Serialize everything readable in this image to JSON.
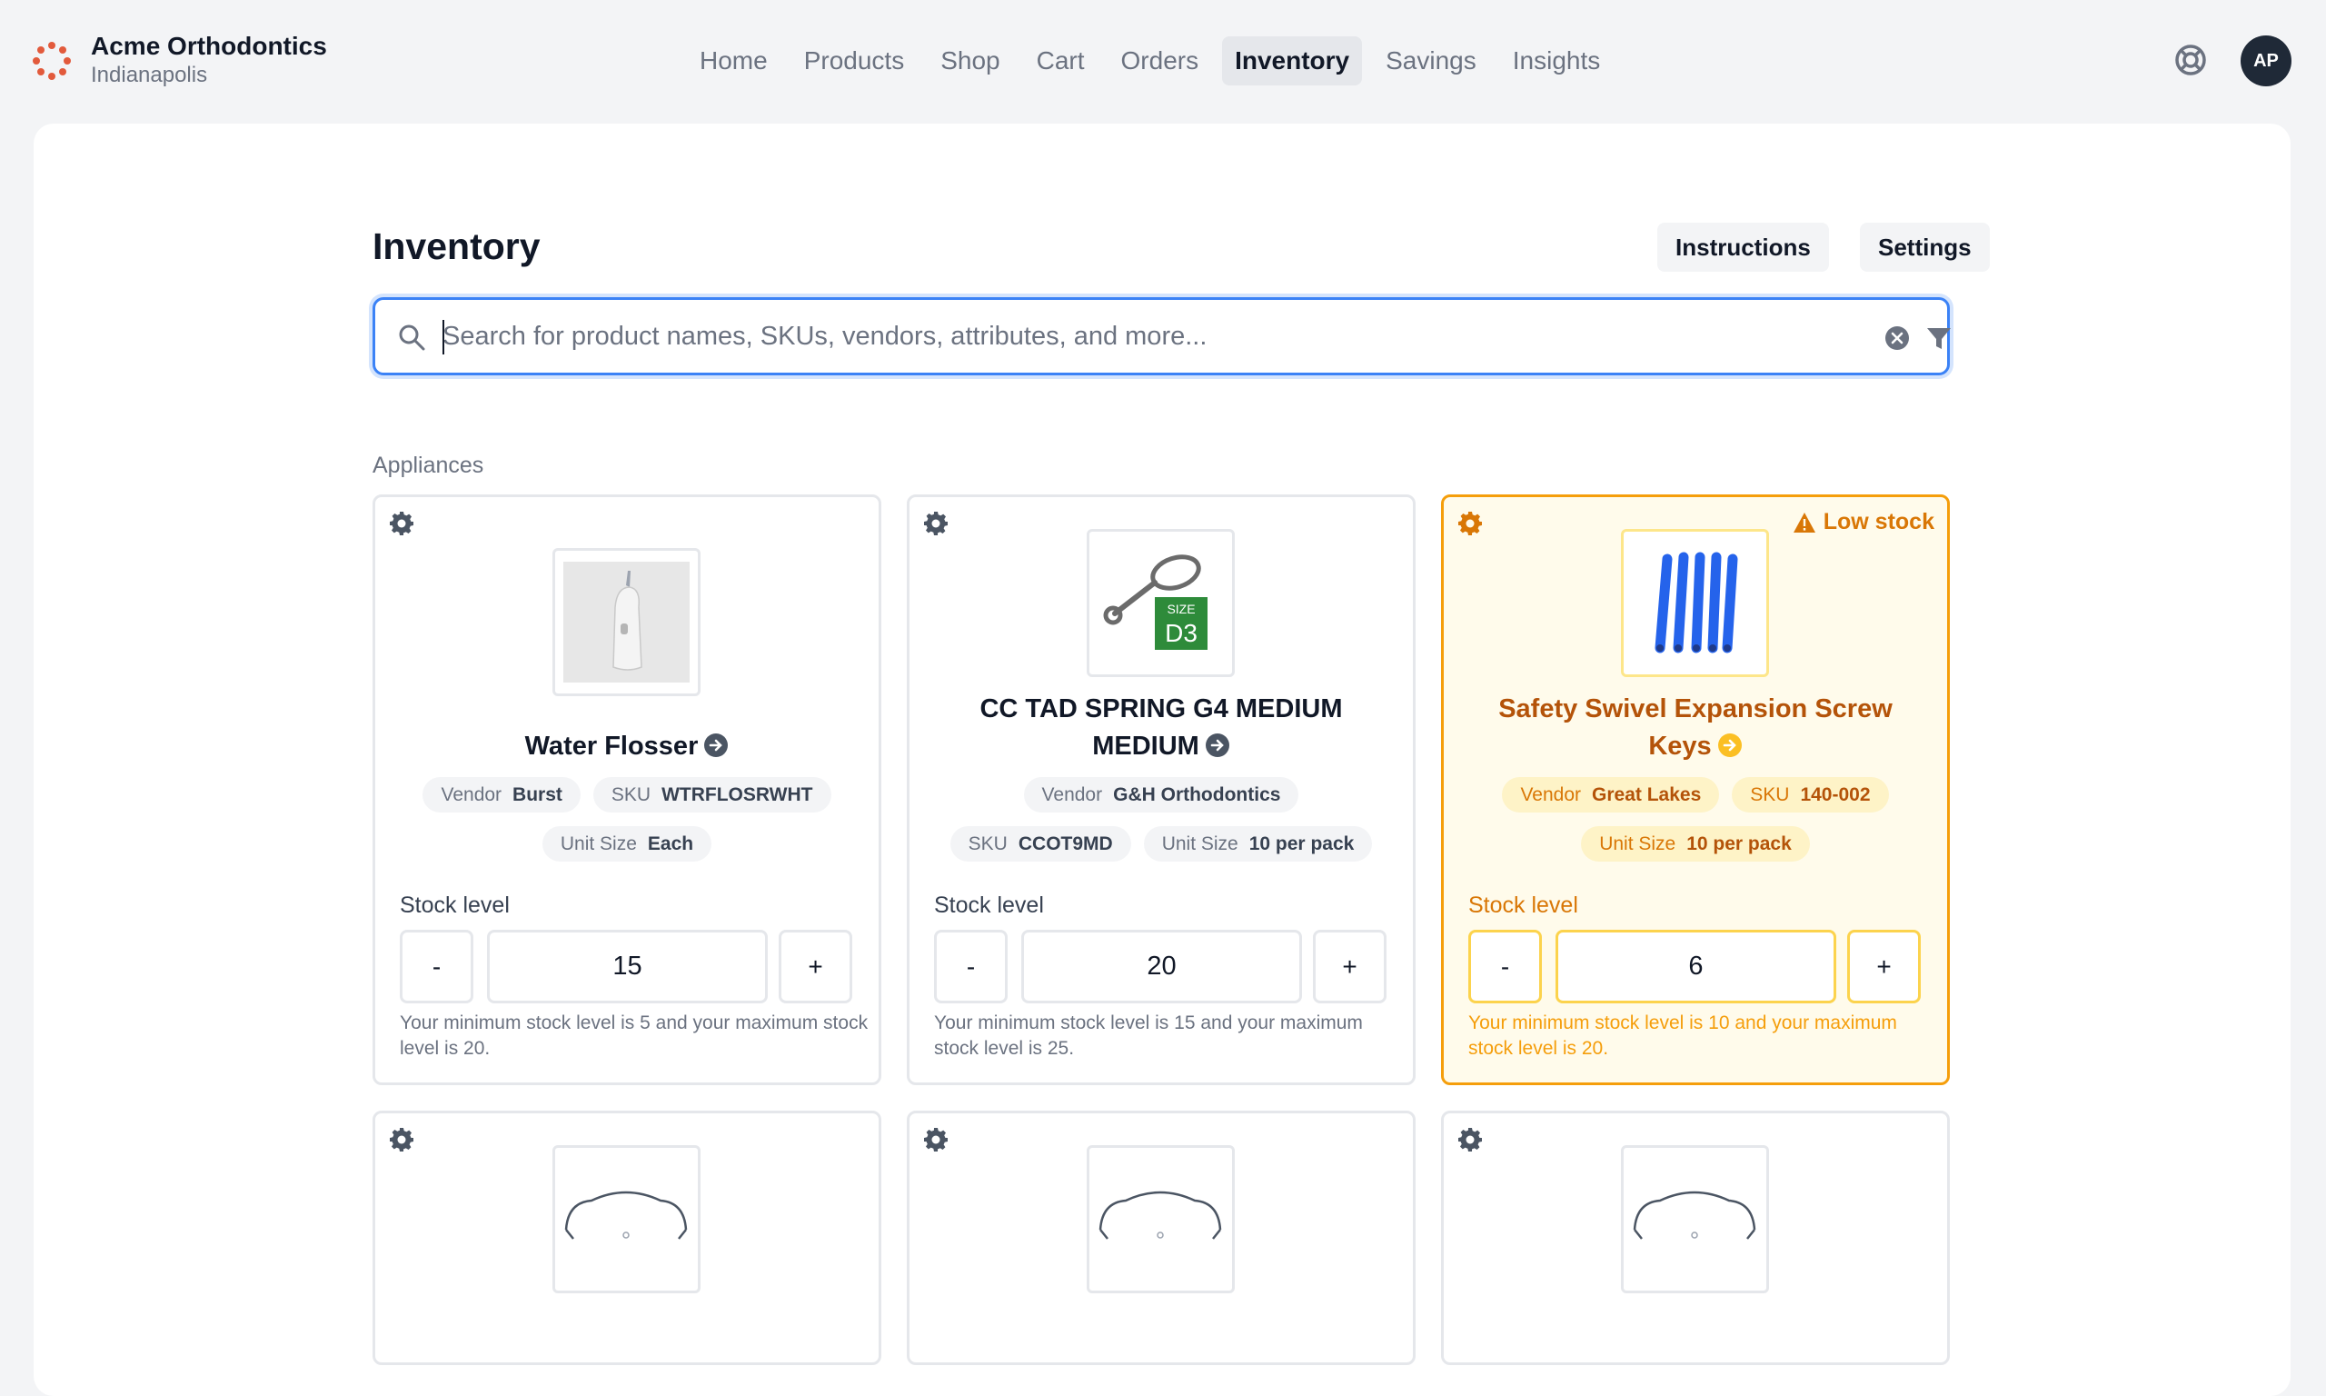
{
  "brand": {
    "name": "Acme Orthodontics",
    "location": "Indianapolis"
  },
  "nav": {
    "items": [
      "Home",
      "Products",
      "Shop",
      "Cart",
      "Orders",
      "Inventory",
      "Savings",
      "Insights"
    ],
    "active": "Inventory"
  },
  "user": {
    "initials": "AP"
  },
  "page": {
    "title": "Inventory",
    "instructions_label": "Instructions",
    "settings_label": "Settings",
    "search_placeholder": "Search for product names, SKUs, vendors, attributes, and more...",
    "section": "Appliances"
  },
  "cards": [
    {
      "name": "Water Flosser",
      "vendor_label": "Vendor",
      "vendor": "Burst",
      "sku_label": "SKU",
      "sku": "WTRFLOSRWHT",
      "unit_label": "Unit Size",
      "unit": "Each",
      "stock_label": "Stock level",
      "stock": "15",
      "note": "Your minimum stock level is 5 and your maximum stock level is 20.",
      "low": false
    },
    {
      "name": "CC TAD SPRING G4 MEDIUM MEDIUM",
      "vendor_label": "Vendor",
      "vendor": "G&H Orthodontics",
      "sku_label": "SKU",
      "sku": "CCOT9MD",
      "unit_label": "Unit Size",
      "unit": "10 per pack",
      "stock_label": "Stock level",
      "stock": "20",
      "note": "Your minimum stock level is 15 and your maximum stock level is 25.",
      "image_text": {
        "size_label": "SIZE",
        "size": "D3"
      },
      "low": false
    },
    {
      "name": "Safety Swivel Expansion Screw Keys",
      "vendor_label": "Vendor",
      "vendor": "Great Lakes",
      "sku_label": "SKU",
      "sku": "140-002",
      "unit_label": "Unit Size",
      "unit": "10 per pack",
      "stock_label": "Stock level",
      "stock": "6",
      "note": "Your minimum stock level is 10 and your maximum stock level is 20.",
      "low": true,
      "badge": "Low stock"
    }
  ],
  "stepper": {
    "minus": "-",
    "plus": "+"
  },
  "colors": {
    "accent": "#3b82f6",
    "warning": "#f59e0b",
    "brand": "#e25a3c"
  },
  "icons": [
    "logo-icon",
    "help-icon",
    "search-icon",
    "clear-icon",
    "filter-icon",
    "gear-icon",
    "arrow-right-icon",
    "warning-icon"
  ]
}
